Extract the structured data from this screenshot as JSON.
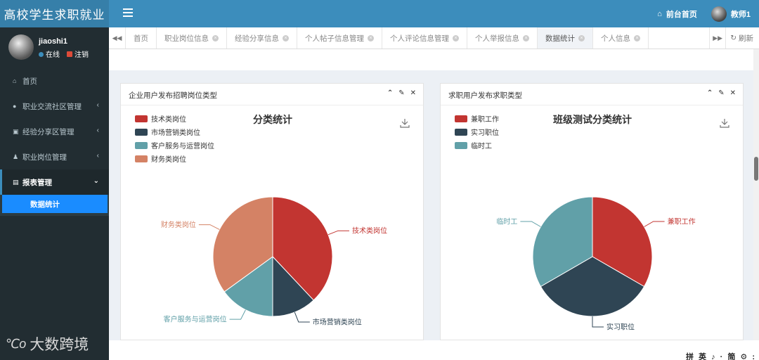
{
  "app": {
    "title": "高校学生求职就业"
  },
  "header": {
    "home_label": "前台首页",
    "user_label": "教师1",
    "colors": {
      "topbar": "#3c8dbc",
      "logo_bg": "#367fa9"
    }
  },
  "sidebar": {
    "username": "jiaoshi1",
    "status_online": "在线",
    "status_logout": "注销",
    "items": [
      {
        "label": "首页",
        "icon": "home-icon"
      },
      {
        "label": "职业交流社区管理",
        "icon": "comments-icon"
      },
      {
        "label": "经验分享区管理",
        "icon": "book-icon"
      },
      {
        "label": "职业岗位管理",
        "icon": "person-icon"
      },
      {
        "label": "报表管理",
        "icon": "table-icon"
      }
    ],
    "active_subitem": "数据统计",
    "watermark": "大数跨境"
  },
  "tabs": {
    "items": [
      {
        "label": "首页",
        "closable": false
      },
      {
        "label": "职业岗位信息",
        "closable": true
      },
      {
        "label": "经验分享信息",
        "closable": true
      },
      {
        "label": "个人帖子信息管理",
        "closable": true
      },
      {
        "label": "个人评论信息管理",
        "closable": true
      },
      {
        "label": "个人举报信息",
        "closable": true
      },
      {
        "label": "数据统计",
        "closable": true,
        "active": true
      },
      {
        "label": "个人信息",
        "closable": true
      }
    ],
    "refresh_label": "刷新"
  },
  "panels": {
    "left": {
      "title": "企业用户发布招聘岗位类型"
    },
    "right": {
      "title": "求职用户发布求职类型"
    }
  },
  "ime_text": "拼 英 ♪ · 简 ⚙ :",
  "chart_data": [
    {
      "type": "pie",
      "title": "分类统计",
      "categories": [
        "技术类岗位",
        "市场营销类岗位",
        "客户服务与运营岗位",
        "财务类岗位"
      ],
      "values": [
        38,
        12,
        15,
        35
      ],
      "colors": [
        "#c23531",
        "#2f4554",
        "#61a0a8",
        "#d48265"
      ],
      "legend_position": "top-left"
    },
    {
      "type": "pie",
      "title": "班级测试分类统计",
      "categories": [
        "兼职工作",
        "实习职位",
        "临时工"
      ],
      "values": [
        1,
        1,
        1
      ],
      "colors": [
        "#c23531",
        "#2f4554",
        "#61a0a8"
      ],
      "legend_position": "top-left"
    }
  ]
}
